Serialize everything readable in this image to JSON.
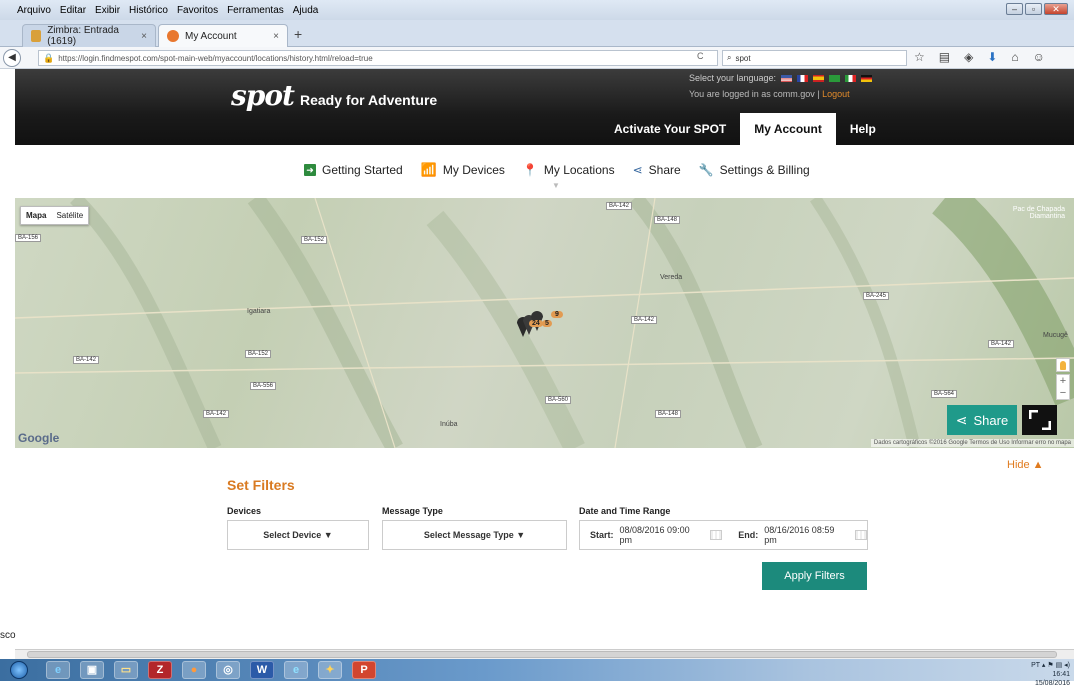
{
  "browser": {
    "menu": [
      "Arquivo",
      "Editar",
      "Exibir",
      "Histórico",
      "Favoritos",
      "Ferramentas",
      "Ajuda"
    ],
    "tabs": [
      {
        "title": "Zimbra: Entrada (1619)",
        "active": false
      },
      {
        "title": "My Account",
        "active": true
      }
    ],
    "url": "https://login.findmespot.com/spot-main-web/myaccount/locations/history.html/reload=true",
    "search_value": "spot"
  },
  "header": {
    "logo": "spot",
    "tagline": "Ready for Adventure",
    "language_label": "Select your language:",
    "login_text": "You are logged in as comm.gov |",
    "logout_label": "Logout",
    "nav": [
      "Activate Your SPOT",
      "My Account",
      "Help"
    ]
  },
  "subnav": {
    "items": [
      "Getting Started",
      "My Devices",
      "My Locations",
      "Share",
      "Settings & Billing"
    ]
  },
  "map": {
    "toggle": [
      "Mapa",
      "Satélite"
    ],
    "labels": [
      "Igatiara",
      "Vereda",
      "Inúba",
      "Pac de Chapada Diamantina",
      "Mucugê"
    ],
    "roads": [
      "BA-156",
      "BA-152",
      "BA-142",
      "BA-148",
      "BA-245",
      "BA-142",
      "BA-152",
      "BA-556",
      "BA-142",
      "BA-148",
      "BA-560",
      "BA-142",
      "BA-564",
      "BA-142"
    ],
    "marker_counts": [
      "9",
      "24",
      "5"
    ],
    "google": "Google",
    "attribution": "Dados cartográficos ©2016 Google   Termos de Uso   Informar erro no mapa",
    "share_label": "Share"
  },
  "filters": {
    "hide_label": "Hide ▲",
    "title": "Set Filters",
    "devices_label": "Devices",
    "devices_value": "Select Device ▼",
    "message_type_label": "Message Type",
    "message_type_value": "Select Message Type ▼",
    "date_label": "Date and Time Range",
    "start_label": "Start:",
    "start_value": "08/08/2016 09:00 pm",
    "end_label": "End:",
    "end_value": "08/16/2016 08:59 pm",
    "apply_label": "Apply Filters"
  },
  "partial_text": "sco",
  "taskbar": {
    "time": "16:41",
    "date": "15/08/2016",
    "lang": "PT"
  }
}
